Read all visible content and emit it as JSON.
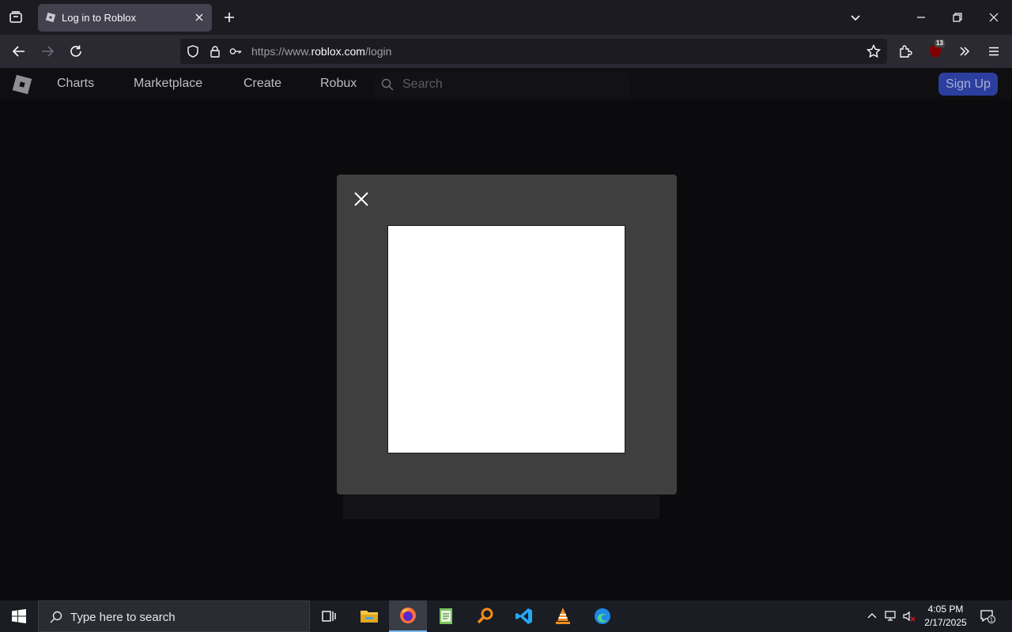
{
  "browser": {
    "tab_title": "Log in to Roblox",
    "url_prefix": "https://www.",
    "url_domain": "roblox.com",
    "url_path": "/login",
    "extension_badge": "13"
  },
  "roblox_header": {
    "nav": [
      "Charts",
      "Marketplace",
      "Create",
      "Robux"
    ],
    "search_placeholder": "Search",
    "signup_label": "Sign Up"
  },
  "modal": {
    "close_icon": "close-icon",
    "content": "captcha-frame"
  },
  "taskbar": {
    "search_placeholder": "Type here to search",
    "apps": [
      "task-view",
      "file-explorer",
      "firefox",
      "notepad",
      "search-tool",
      "vscode",
      "vlc",
      "edge"
    ],
    "time": "4:05 PM",
    "date": "2/17/2025",
    "notification_count": "1"
  },
  "colors": {
    "accent_signup": "#2c3e9e",
    "modal_bg": "#3f3f3f",
    "page_bg": "#0b0b0d"
  }
}
